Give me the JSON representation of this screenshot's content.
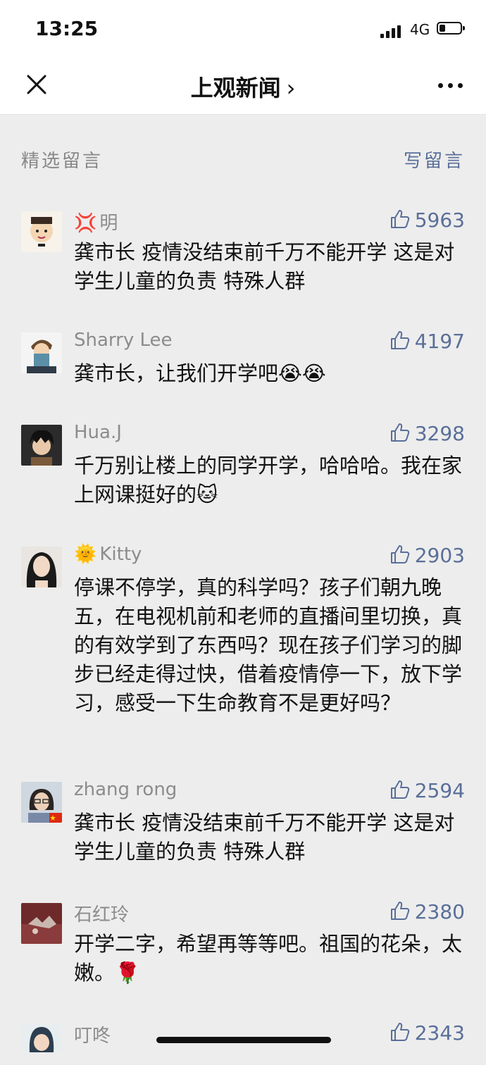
{
  "status_bar": {
    "time": "13:25",
    "network": "4G"
  },
  "nav": {
    "title": "上观新闻",
    "chevron": "›"
  },
  "section": {
    "title": "精选留言",
    "write_link": "写留言"
  },
  "comments": [
    {
      "name": "明",
      "name_emoji": "💢",
      "likes": "5963",
      "text": "龚市长 疫情没结束前千万不能开学 这是对学生儿童的负责 特殊人群",
      "avatar": "cartoon-face"
    },
    {
      "name": "Sharry Lee",
      "name_emoji": "",
      "likes": "4197",
      "text": "龚市长，让我们开学吧😭😭",
      "avatar": "cartoon-reader"
    },
    {
      "name": "Hua.J",
      "name_emoji": "",
      "likes": "3298",
      "text": "千万别让楼上的同学开学，哈哈哈。我在家上网课挺好的🐱",
      "avatar": "anime-boy"
    },
    {
      "name": "Kitty",
      "name_emoji": "🌞",
      "likes": "2903",
      "text": "停课不停学，真的科学吗？孩子们朝九晚五，在电视机前和老师的直播间里切换，真的有效学到了东西吗？现在孩子们学习的脚步已经走得过快，借着疫情停一下，放下学习，感受一下生命教育不是更好吗？",
      "avatar": "woman-photo"
    },
    {
      "name": "zhang rong",
      "name_emoji": "",
      "likes": "2594",
      "text": "龚市长 疫情没结束前千万不能开学 这是对学生儿童的负责 特殊人群",
      "avatar": "woman-glasses"
    },
    {
      "name": "石红玲",
      "name_emoji": "",
      "likes": "2380",
      "text": "开学二字，希望再等等吧。祖国的花朵，太嫩。🌹",
      "avatar": "flower-photo"
    },
    {
      "name": "叮咚",
      "name_emoji": "",
      "likes": "2343",
      "text": "",
      "avatar": "cartoon-girl"
    }
  ],
  "colors": {
    "accent": "#5a6f99",
    "background": "#ededed",
    "muted": "#8c8c8c"
  },
  "icons": {
    "close": "close-icon",
    "more": "more-icon",
    "like": "thumbs-up-icon"
  }
}
